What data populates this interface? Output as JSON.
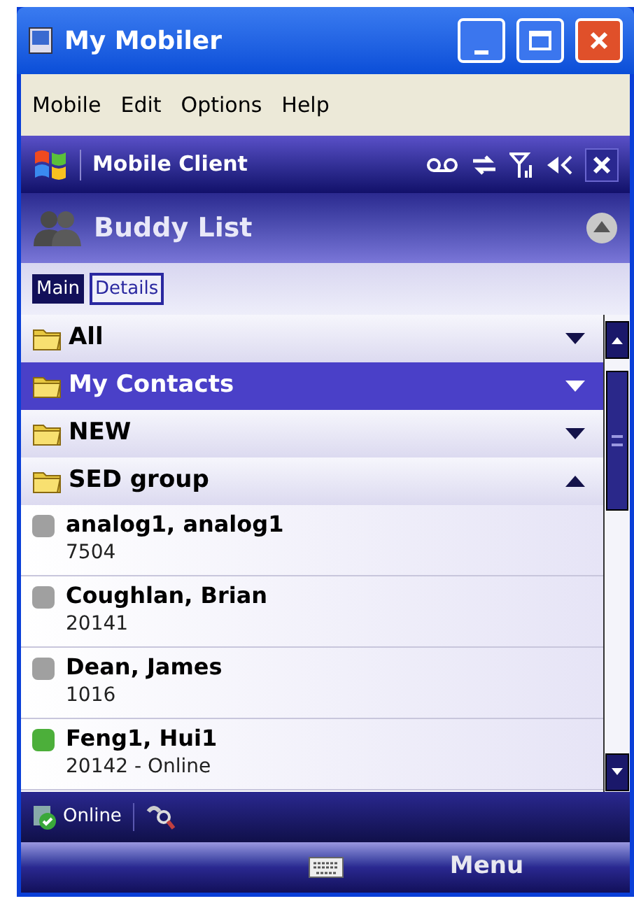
{
  "window": {
    "title": "My Mobiler"
  },
  "menu": [
    "Mobile",
    "Edit",
    "Options",
    "Help"
  ],
  "device_title": "Mobile Client",
  "header": {
    "title": "Buddy List"
  },
  "tabs": [
    {
      "label": "Main",
      "selected": true
    },
    {
      "label": "Details",
      "selected": false
    }
  ],
  "groups": [
    {
      "name": "All",
      "selected": false,
      "expanded": false
    },
    {
      "name": "My Contacts",
      "selected": true,
      "expanded": false
    },
    {
      "name": "NEW",
      "selected": false,
      "expanded": false
    },
    {
      "name": "SED group",
      "selected": false,
      "expanded": true
    }
  ],
  "contacts": [
    {
      "name": "analog1, analog1",
      "detail": "7504",
      "color": "#a0a0a0"
    },
    {
      "name": "Coughlan, Brian",
      "detail": "20141",
      "color": "#a0a0a0"
    },
    {
      "name": "Dean, James",
      "detail": "1016",
      "color": "#a0a0a0"
    },
    {
      "name": "Feng1, Hui1",
      "detail": "20142 - Online",
      "color": "#4caf3a"
    }
  ],
  "status": {
    "label": "Online"
  },
  "softkeys": {
    "right": "Menu"
  }
}
